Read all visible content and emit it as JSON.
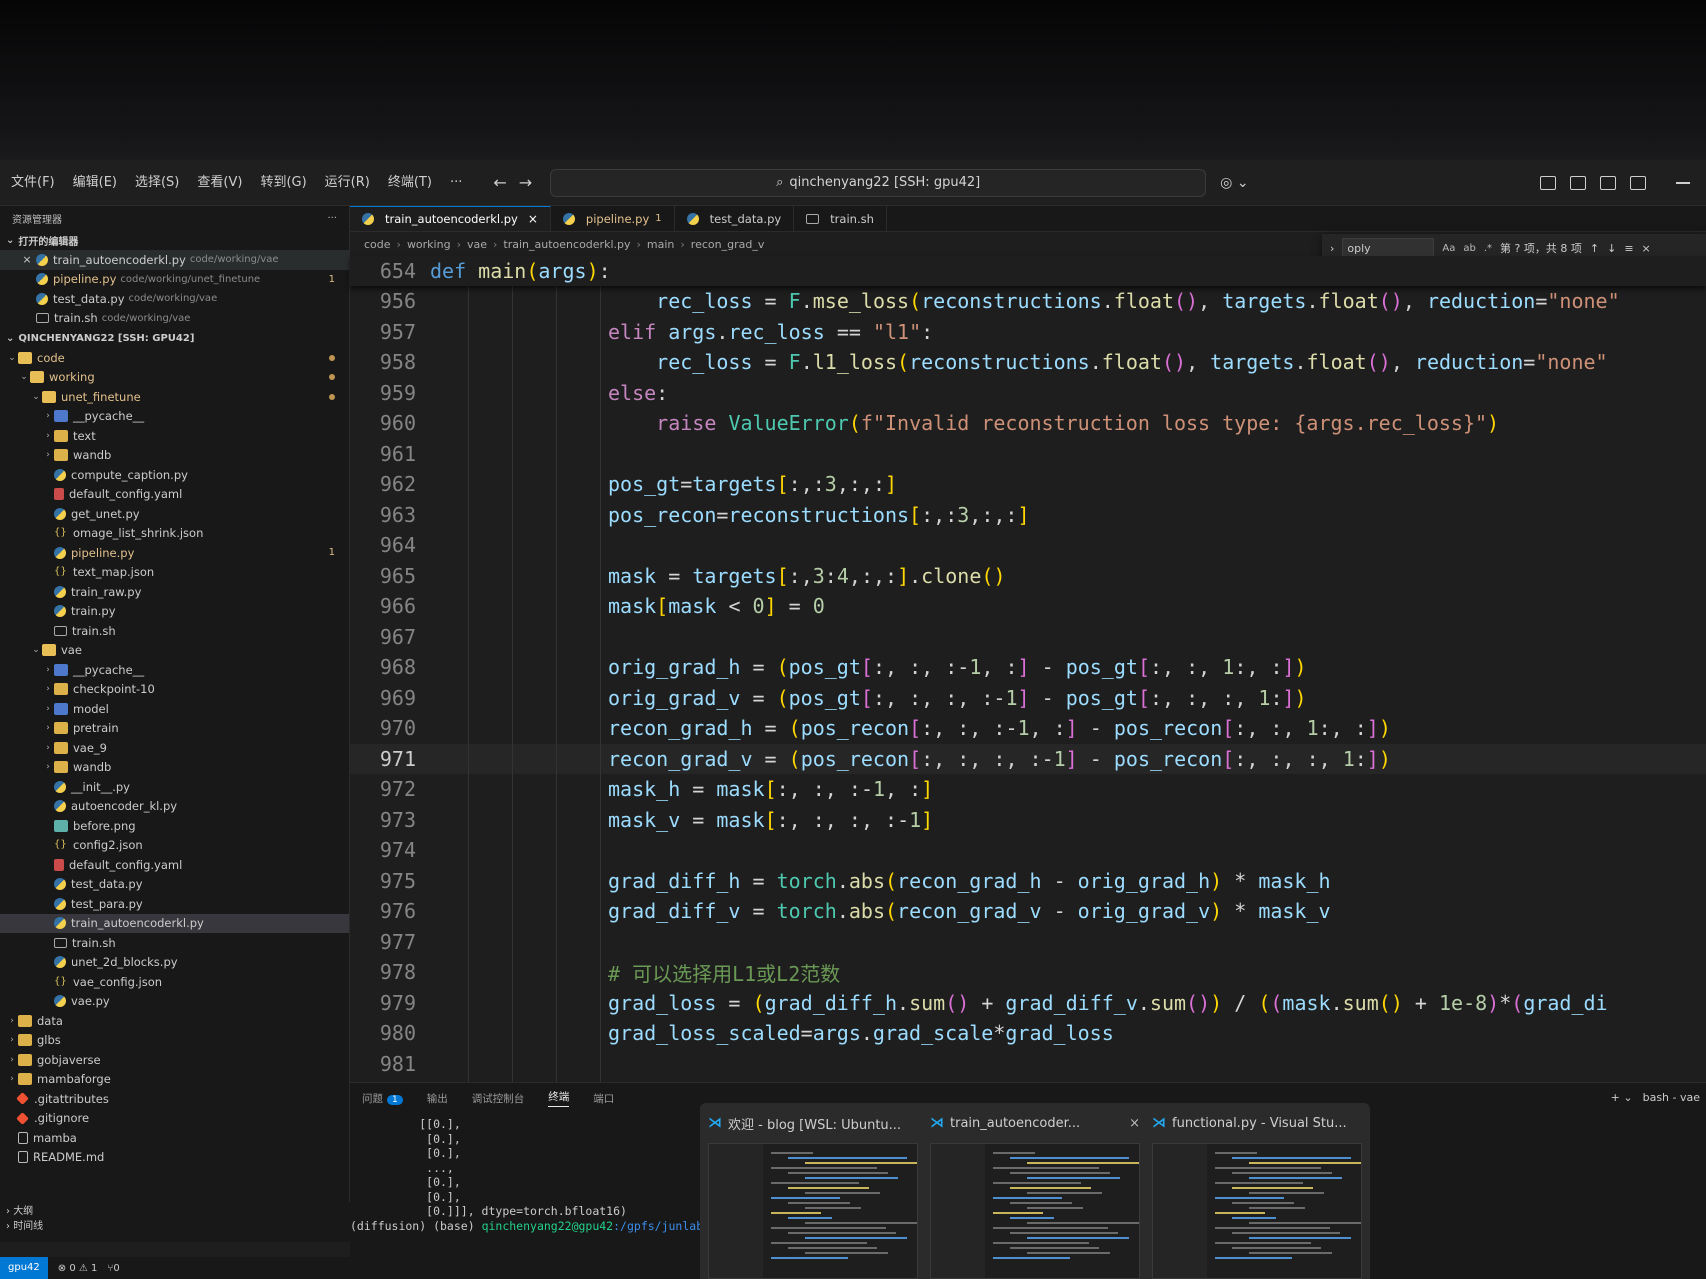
{
  "menus": [
    "文件(F)",
    "编辑(E)",
    "选择(S)",
    "查看(V)",
    "转到(G)",
    "运行(R)",
    "终端(T)",
    "···"
  ],
  "command_center": {
    "text": "qinchenyang22 [SSH: gpu42]"
  },
  "sidebar": {
    "title": "资源管理器",
    "open_editors_label": "打开的编辑器",
    "open_editors": [
      {
        "name": "train_autoencoderkl.py",
        "path": "code/working/vae",
        "close": "×"
      },
      {
        "name": "pipeline.py",
        "path": "code/working/unet_finetune",
        "badge": "1"
      },
      {
        "name": "test_data.py",
        "path": "code/working/vae"
      },
      {
        "name": "train.sh",
        "path": "code/working/vae"
      }
    ],
    "workspace_label": "QINCHENYANG22 [SSH: GPU42]",
    "tree": [
      {
        "depth": 0,
        "type": "folder-open",
        "name": "code",
        "chev": "v",
        "mod": true
      },
      {
        "depth": 1,
        "type": "folder-open",
        "name": "working",
        "chev": "v",
        "mod": true
      },
      {
        "depth": 2,
        "type": "folder-open",
        "name": "unet_finetune",
        "chev": "v",
        "mod": true
      },
      {
        "depth": 3,
        "type": "pyc",
        "name": "__pycache__",
        "chev": ">"
      },
      {
        "depth": 3,
        "type": "folder",
        "name": "text",
        "chev": ">"
      },
      {
        "depth": 3,
        "type": "folder",
        "name": "wandb",
        "chev": ">"
      },
      {
        "depth": 3,
        "type": "py",
        "name": "compute_caption.py"
      },
      {
        "depth": 3,
        "type": "yaml",
        "name": "default_config.yaml"
      },
      {
        "depth": 3,
        "type": "py",
        "name": "get_unet.py"
      },
      {
        "depth": 3,
        "type": "json",
        "name": "omage_list_shrink.json"
      },
      {
        "depth": 3,
        "type": "py",
        "name": "pipeline.py",
        "mod": true,
        "badge": "1"
      },
      {
        "depth": 3,
        "type": "json",
        "name": "text_map.json"
      },
      {
        "depth": 3,
        "type": "py",
        "name": "train_raw.py"
      },
      {
        "depth": 3,
        "type": "py",
        "name": "train.py"
      },
      {
        "depth": 3,
        "type": "sh",
        "name": "train.sh"
      },
      {
        "depth": 2,
        "type": "folder-open",
        "name": "vae",
        "chev": "v"
      },
      {
        "depth": 3,
        "type": "pyc",
        "name": "__pycache__",
        "chev": ">"
      },
      {
        "depth": 3,
        "type": "folder",
        "name": "checkpoint-10",
        "chev": ">"
      },
      {
        "depth": 3,
        "type": "pyc",
        "name": "model",
        "chev": ">"
      },
      {
        "depth": 3,
        "type": "folder",
        "name": "pretrain",
        "chev": ">"
      },
      {
        "depth": 3,
        "type": "folder",
        "name": "vae_9",
        "chev": ">"
      },
      {
        "depth": 3,
        "type": "folder",
        "name": "wandb",
        "chev": ">"
      },
      {
        "depth": 3,
        "type": "py",
        "name": "__init__.py"
      },
      {
        "depth": 3,
        "type": "py",
        "name": "autoencoder_kl.py"
      },
      {
        "depth": 3,
        "type": "png",
        "name": "before.png"
      },
      {
        "depth": 3,
        "type": "json",
        "name": "config2.json"
      },
      {
        "depth": 3,
        "type": "yaml",
        "name": "default_config.yaml"
      },
      {
        "depth": 3,
        "type": "py",
        "name": "test_data.py"
      },
      {
        "depth": 3,
        "type": "py",
        "name": "test_para.py"
      },
      {
        "depth": 3,
        "type": "py",
        "name": "train_autoencoderkl.py",
        "selected": true
      },
      {
        "depth": 3,
        "type": "sh",
        "name": "train.sh"
      },
      {
        "depth": 3,
        "type": "py",
        "name": "unet_2d_blocks.py"
      },
      {
        "depth": 3,
        "type": "json",
        "name": "vae_config.json"
      },
      {
        "depth": 3,
        "type": "py",
        "name": "vae.py"
      },
      {
        "depth": 0,
        "type": "folder",
        "name": "data",
        "chev": ">"
      },
      {
        "depth": 0,
        "type": "folder",
        "name": "glbs",
        "chev": ">"
      },
      {
        "depth": 0,
        "type": "folder",
        "name": "gobjaverse",
        "chev": ">"
      },
      {
        "depth": 0,
        "type": "folder",
        "name": "mambaforge",
        "chev": ">"
      },
      {
        "depth": 0,
        "type": "git",
        "name": ".gitattributes"
      },
      {
        "depth": 0,
        "type": "git",
        "name": ".gitignore"
      },
      {
        "depth": 0,
        "type": "plain",
        "name": "mamba"
      },
      {
        "depth": 0,
        "type": "md",
        "name": "README.md"
      }
    ],
    "outline_label": "大纲",
    "timeline_label": "时间线"
  },
  "tabs": [
    {
      "name": "train_autoencoderkl.py",
      "active": true,
      "close": "×"
    },
    {
      "name": "pipeline.py",
      "modified": true,
      "badge": "1"
    },
    {
      "name": "test_data.py"
    },
    {
      "name": "train.sh"
    }
  ],
  "breadcrumbs": [
    "code",
    "working",
    "vae",
    "train_autoencoderkl.py",
    "main",
    "recon_grad_v"
  ],
  "find": {
    "value": "oply",
    "opts": [
      "Aa",
      "ab",
      ".*"
    ],
    "count": "第 ? 项，共 8 项"
  },
  "sticky": {
    "line": "654",
    "code": "def main(args):"
  },
  "code_lines": [
    {
      "n": "956",
      "t": "    rec_loss = F.mse_loss(reconstructions.float(), targets.float(), reduction=\"none\""
    },
    {
      "n": "957",
      "t": "elif args.rec_loss == \"l1\":"
    },
    {
      "n": "958",
      "t": "    rec_loss = F.l1_loss(reconstructions.float(), targets.float(), reduction=\"none\""
    },
    {
      "n": "959",
      "t": "else:"
    },
    {
      "n": "960",
      "t": "    raise ValueError(f\"Invalid reconstruction loss type: {args.rec_loss}\")"
    },
    {
      "n": "961",
      "t": ""
    },
    {
      "n": "962",
      "t": "pos_gt=targets[:,:3,:,:]"
    },
    {
      "n": "963",
      "t": "pos_recon=reconstructions[:,:3,:,:]"
    },
    {
      "n": "964",
      "t": ""
    },
    {
      "n": "965",
      "t": "mask = targets[:,3:4,:,:].clone()"
    },
    {
      "n": "966",
      "t": "mask[mask < 0] = 0"
    },
    {
      "n": "967",
      "t": ""
    },
    {
      "n": "968",
      "t": "orig_grad_h = (pos_gt[:, :, :-1, :] - pos_gt[:, :, 1:, :])"
    },
    {
      "n": "969",
      "t": "orig_grad_v = (pos_gt[:, :, :, :-1] - pos_gt[:, :, :, 1:])"
    },
    {
      "n": "970",
      "t": "recon_grad_h = (pos_recon[:, :, :-1, :] - pos_recon[:, :, 1:, :])"
    },
    {
      "n": "971",
      "t": "recon_grad_v = (pos_recon[:, :, :, :-1] - pos_recon[:, :, :, 1:])",
      "current": true
    },
    {
      "n": "972",
      "t": "mask_h = mask[:, :, :-1, :]"
    },
    {
      "n": "973",
      "t": "mask_v = mask[:, :, :, :-1]"
    },
    {
      "n": "974",
      "t": ""
    },
    {
      "n": "975",
      "t": "grad_diff_h = torch.abs(recon_grad_h - orig_grad_h) * mask_h"
    },
    {
      "n": "976",
      "t": "grad_diff_v = torch.abs(recon_grad_v - orig_grad_v) * mask_v"
    },
    {
      "n": "977",
      "t": ""
    },
    {
      "n": "978",
      "t": "# 可以选择用L1或L2范数",
      "comment": true
    },
    {
      "n": "979",
      "t": "grad_loss = (grad_diff_h.sum() + grad_diff_v.sum()) / ((mask.sum() + 1e-8)*(grad_di"
    },
    {
      "n": "980",
      "t": "grad_loss_scaled=args.grad_scale*grad_loss"
    },
    {
      "n": "981",
      "t": ""
    }
  ],
  "panel": {
    "tabs": [
      {
        "label": "问题",
        "badge": "1"
      },
      {
        "label": "输出"
      },
      {
        "label": "调试控制台"
      },
      {
        "label": "终端",
        "active": true
      },
      {
        "label": "端口"
      }
    ],
    "right": {
      "add": "+ ⌄",
      "shell": "bash - vae"
    },
    "terminal": [
      "          [[0.],",
      "           [0.],",
      "           [0.],",
      "           ...,",
      "           [0.],",
      "           [0.],",
      "           [0.]]], dtype=torch.bfloat16)"
    ],
    "prompt": {
      "env": "(diffusion) (base) ",
      "user": "qinchenyang22@gpu42",
      "path": ":/gpfs/junlab/"
    }
  },
  "statusbar": {
    "remote": "gpu42",
    "problems": "⊗ 0 ⚠ 1",
    "ports": "⑂0"
  },
  "taskbar_thumbs": [
    {
      "title": "欢迎 - blog [WSL: Ubuntu..."
    },
    {
      "title": "train_autoencoder...",
      "close": "×"
    },
    {
      "title": "functional.py - Visual Stu..."
    }
  ]
}
